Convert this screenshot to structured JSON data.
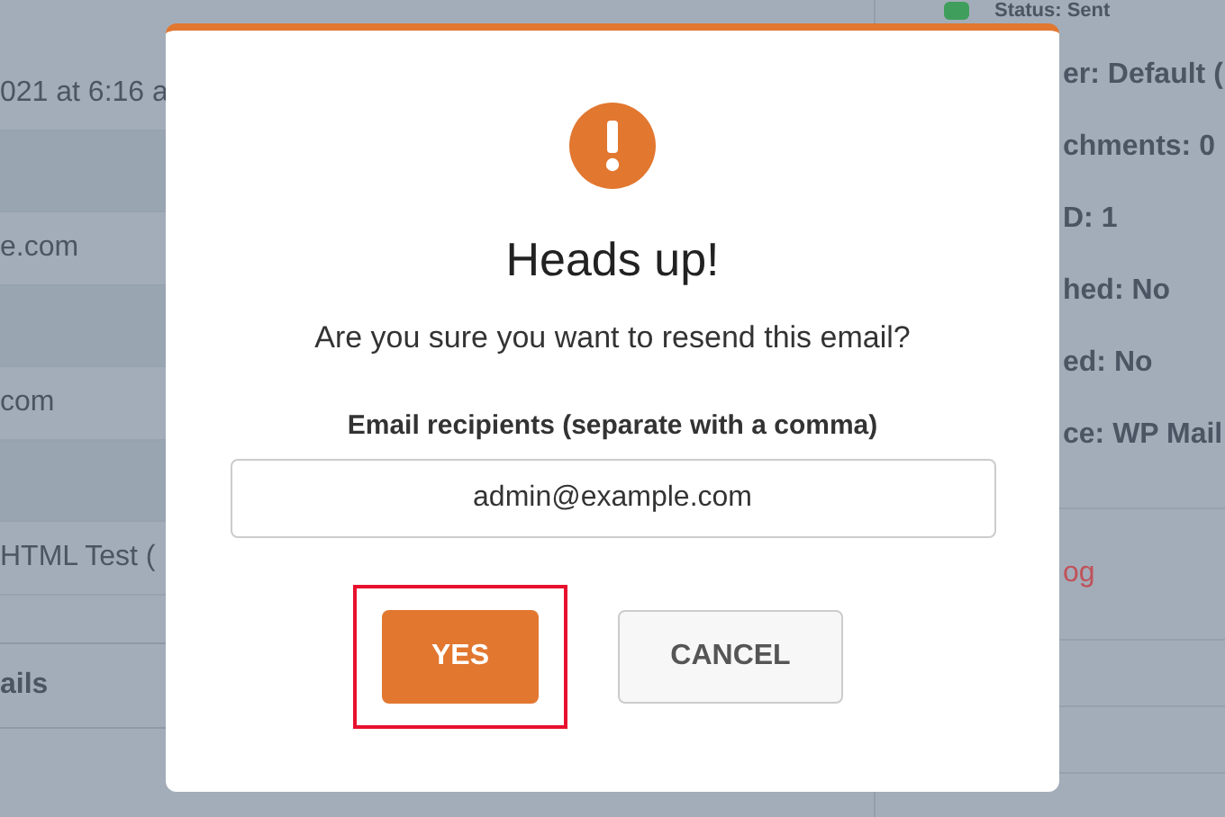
{
  "background": {
    "left_rows": [
      {
        "kind": "text",
        "text": "021 at 6:16 a"
      },
      {
        "kind": "band"
      },
      {
        "kind": "text",
        "text": "e.com"
      },
      {
        "kind": "band"
      },
      {
        "kind": "text",
        "text": "com"
      },
      {
        "kind": "band"
      },
      {
        "kind": "text",
        "text": "HTML Test ("
      },
      {
        "kind": "heading",
        "text": "ails"
      }
    ],
    "status": {
      "text": "Status: Sent",
      "color": "#3f9e5c"
    },
    "details": [
      "er: Default (",
      "chments: 0",
      "D: 1",
      "hed: No",
      "ed: No",
      "ce: WP Mail"
    ],
    "link": "og"
  },
  "dialog": {
    "title": "Heads up!",
    "message": "Are you sure you want to resend this email?",
    "field": {
      "label": "Email recipients (separate with a comma)",
      "value": "admin@example.com"
    },
    "buttons": [
      {
        "label": "YES",
        "kind": "primary",
        "highlighted": true
      },
      {
        "label": "CANCEL",
        "kind": "secondary",
        "highlighted": false
      }
    ]
  }
}
